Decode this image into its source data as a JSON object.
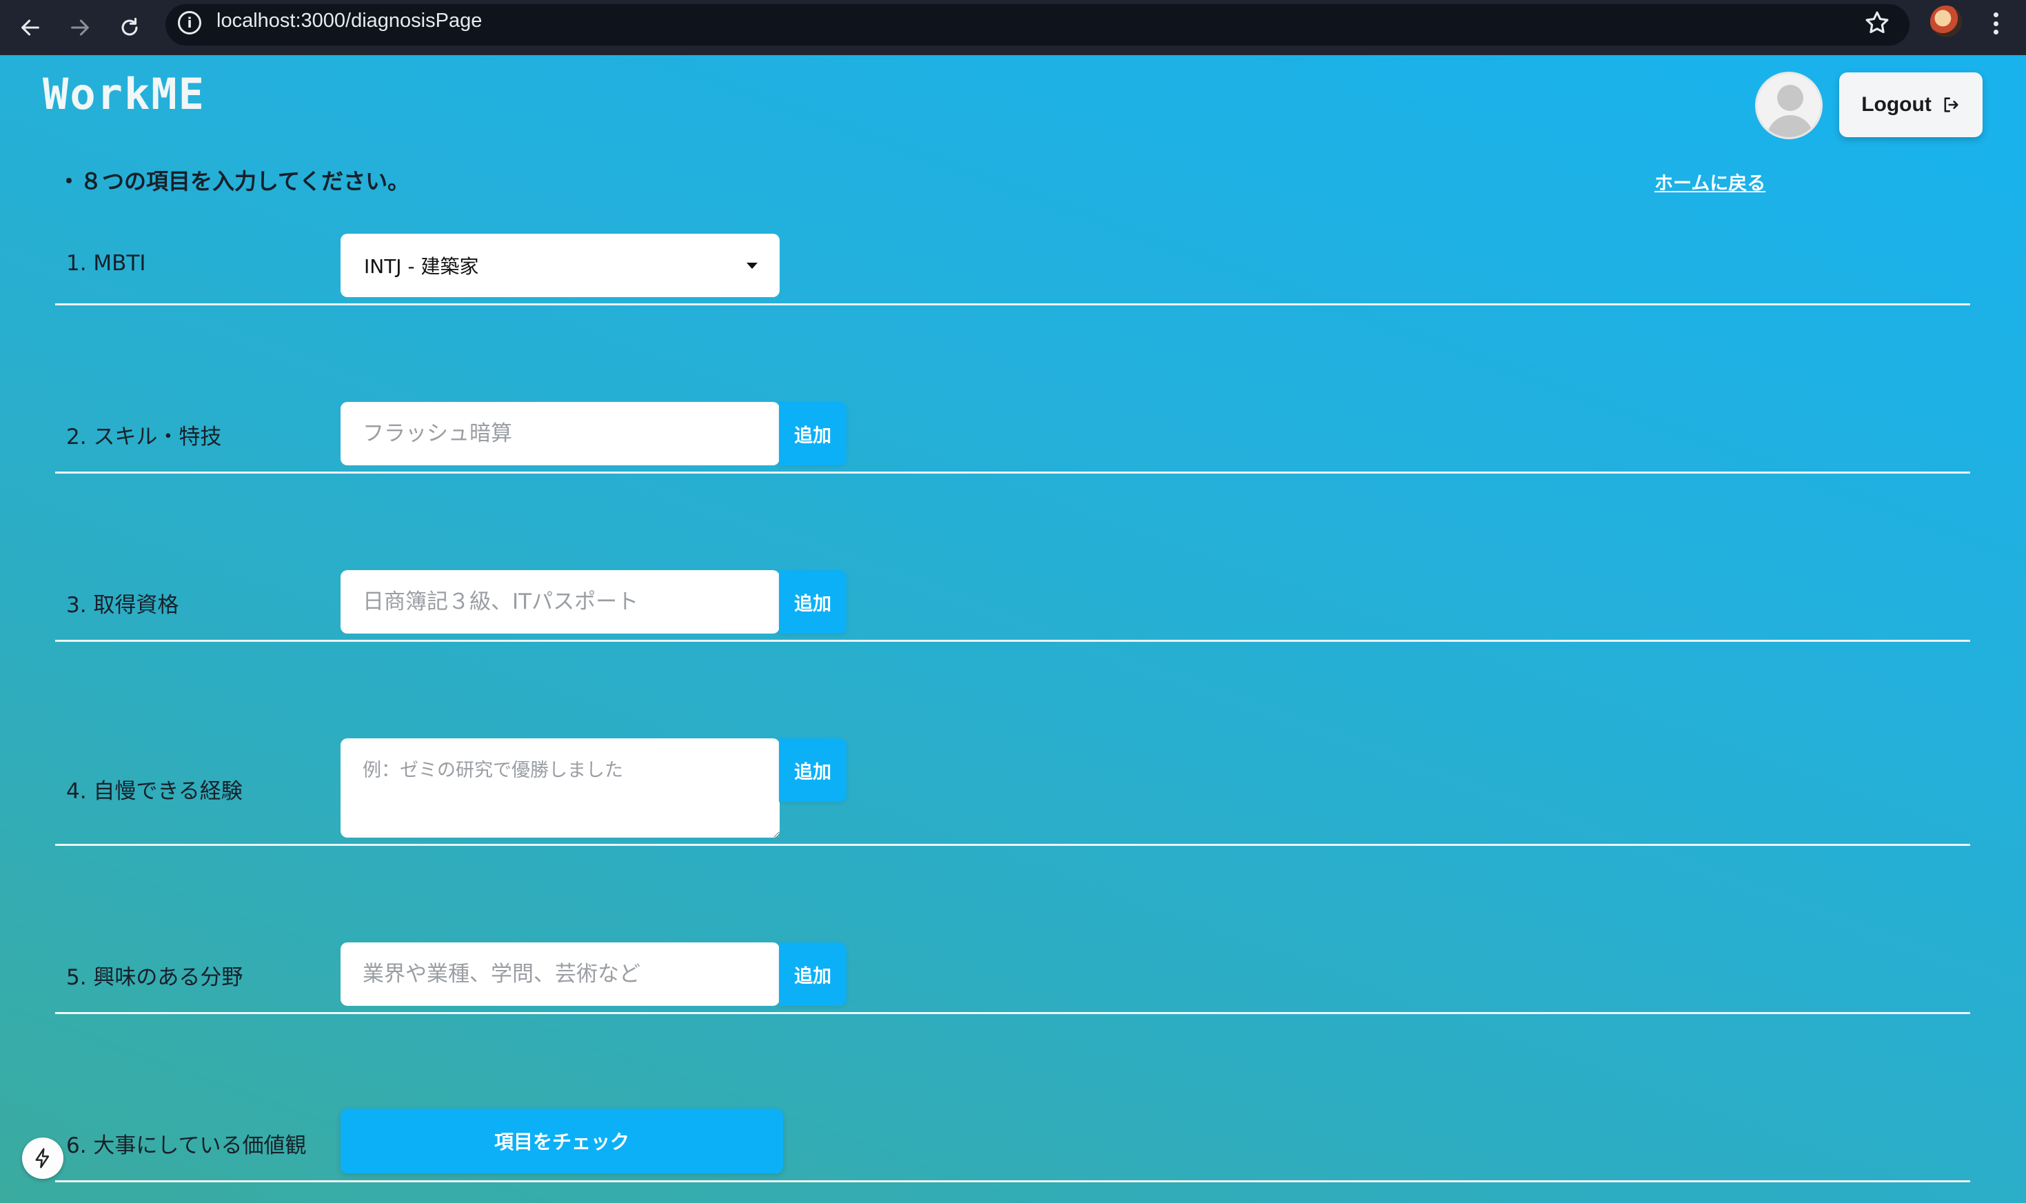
{
  "browser": {
    "url": "localhost:3000/diagnosisPage",
    "icons": [
      "back-arrow-icon",
      "forward-arrow-icon",
      "reload-icon",
      "site-info-icon",
      "bookmark-star-icon",
      "menu-dots-icon"
    ]
  },
  "header": {
    "logo": "WorkME",
    "logout_label": "Logout"
  },
  "instruction": "・８つの項目を入力してください。",
  "home_link": "ホームに戻る",
  "add_label": "追加",
  "fields": {
    "mbti": {
      "label": "1. MBTI",
      "selected": "INTJ - 建築家"
    },
    "skills": {
      "label": "2. スキル・特技",
      "placeholder": "フラッシュ暗算"
    },
    "qualifications": {
      "label": "3. 取得資格",
      "placeholder": "日商簿記３級、ITパスポート"
    },
    "experience": {
      "label": "4. 自慢できる経験",
      "placeholder": "例：ゼミの研究で優勝しました"
    },
    "interests": {
      "label": "5. 興味のある分野",
      "placeholder": "業界や業種、学問、芸術など"
    },
    "values": {
      "label": "6. 大事にしている価値観",
      "button_label": "項目をチェック"
    }
  },
  "colors": {
    "accent": "#0cb0f7",
    "gradient_top": "#18b2ee",
    "gradient_bottom": "#3bab9f"
  }
}
